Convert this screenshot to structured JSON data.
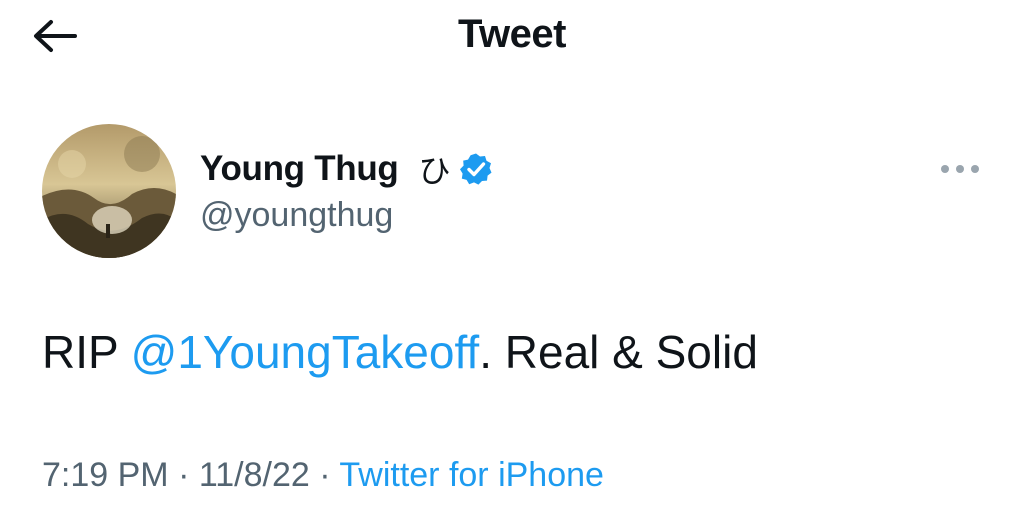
{
  "header": {
    "title": "Tweet",
    "back_icon": "arrow-left-icon"
  },
  "author": {
    "display_name": "Young Thug",
    "name_glyph": "ひ",
    "handle": "@youngthug",
    "verified": true,
    "verified_icon": "verified-badge-icon",
    "avatar_icon": "profile-avatar"
  },
  "more_icon": "more-horizontal-icon",
  "tweet": {
    "text_prefix": "RIP ",
    "mention": "@1YoungTakeoff",
    "text_suffix": ". Real & Solid"
  },
  "meta": {
    "time": "7:19 PM",
    "separator": " · ",
    "date": "11/8/22",
    "source": "Twitter for iPhone"
  },
  "colors": {
    "link": "#1d9bf0",
    "secondary_text": "#536471",
    "primary_text": "#0f1419"
  }
}
